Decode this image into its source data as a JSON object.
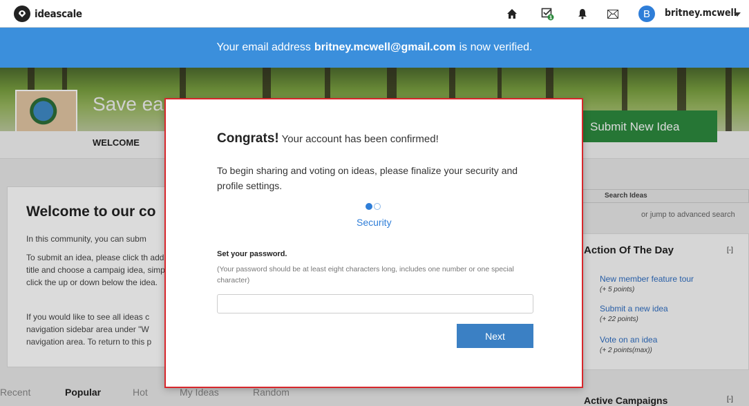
{
  "topbar": {
    "logo_text": "ideascale",
    "icons": [
      "home-icon",
      "ideas-check-icon",
      "bell-icon",
      "envelope-icon"
    ],
    "avatar_letter": "B",
    "username": "britney.mcwell",
    "accent": "#2f7ed8"
  },
  "banner": {
    "prefix": "Your email address",
    "email": "britney.mcwell@gmail.com",
    "suffix": "is now verified.",
    "color": "#3b8fdc"
  },
  "background": {
    "site_title": "Save ea",
    "welcome_tab": "WELCOME",
    "submit_button": "Submit New Idea",
    "heading": "Welcome to our co",
    "para1": "In this community, you can subm",
    "para2": "To submit an idea, please click th add a title and choose a campaig idea, simply click the up or down below the idea.",
    "para3": "If you would like to see all ideas c navigation sidebar area under \"W navigation area. To return to this p",
    "tabs": [
      "Recent",
      "Popular",
      "Hot",
      "My Ideas",
      "Random"
    ],
    "search_label": "Search Ideas",
    "advanced_search": "or jump to advanced search",
    "action_heading": "Action Of The Day",
    "collapse": "[-]",
    "actions": [
      {
        "label": "New member feature tour",
        "points": "(+ 5 points)"
      },
      {
        "label": "Submit a new idea",
        "points": "(+ 22 points)"
      },
      {
        "label": "Vote on an idea",
        "points": "(+ 2 points(max))"
      }
    ],
    "active_campaigns": "Active Campaigns"
  },
  "modal": {
    "title_bold": "Congrats!",
    "title_rest": "Your account has been confirmed!",
    "intro": "To begin sharing and voting on ideas, please finalize your security and profile settings.",
    "step_label": "Security",
    "step_current": 1,
    "step_total": 2,
    "password_label": "Set your password.",
    "password_hint": "(Your password should be at least eight characters long, includes one number or one special character)",
    "password_value": "",
    "next_button": "Next",
    "border_color": "#d7262b"
  }
}
